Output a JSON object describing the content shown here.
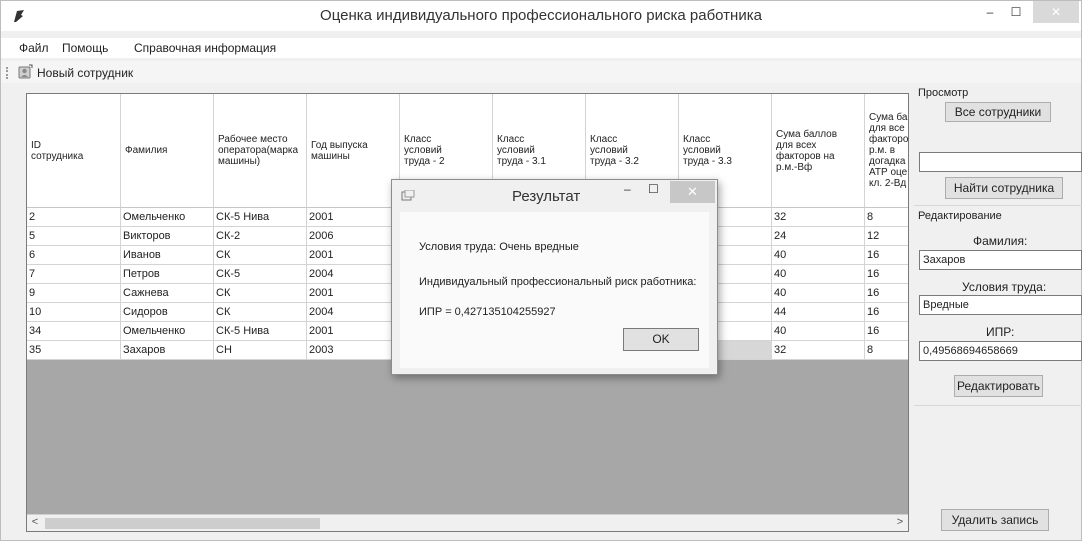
{
  "window": {
    "title": "Оценка индивидуального профессионального риска работника",
    "min_glyph": "–",
    "max_glyph": "☐",
    "close_glyph": "✕"
  },
  "menu": [
    "Файл",
    "Помощь",
    "Справочная информация"
  ],
  "toolbar": {
    "new_employee_label": "Новый сотрудник"
  },
  "grid": {
    "columns": [
      "ID\nсотрудника",
      "Фамилия",
      "Рабочее место\nоператора(марка\nмашины)",
      "Год выпуска\nмашины",
      "Класс\nусловий\nтруда - 2",
      "Класс\nусловий\nтруда - 3.1",
      "Класс\nусловий\nтруда - 3.2",
      "Класс\nусловий\nтруда - 3.3",
      "Сума баллов\nдля всех\nфакторов на\nр.м.-Вф",
      "Сума ба\nдля все\nфакторо\nр.м. в\nдогадка\nАТР оце\nкл. 2-Вд"
    ],
    "rows": [
      [
        "2",
        "Омельченко",
        "СК-5 Нива",
        "2001",
        "",
        "",
        "",
        "",
        "32",
        "8"
      ],
      [
        "5",
        "Викторов",
        "СК-2",
        "2006",
        "",
        "",
        "",
        "",
        "24",
        "12"
      ],
      [
        "6",
        "Иванов",
        "СК",
        "2001",
        "",
        "",
        "",
        "",
        "40",
        "16"
      ],
      [
        "7",
        "Петров",
        "СК-5",
        "2004",
        "",
        "",
        "",
        "",
        "40",
        "16"
      ],
      [
        "9",
        "Сажнева",
        "СК",
        "2001",
        "",
        "",
        "",
        "",
        "40",
        "16"
      ],
      [
        "10",
        "Сидоров",
        "СК",
        "2004",
        "",
        "",
        "",
        "",
        "44",
        "16"
      ],
      [
        "34",
        "Омельченко",
        "СК-5 Нива",
        "2001",
        "",
        "",
        "",
        "",
        "40",
        "16"
      ],
      [
        "35",
        "Захаров",
        "СН",
        "2003",
        "",
        "",
        "",
        "",
        "32",
        "8"
      ]
    ],
    "selected_row": 7,
    "scroll_left": "<",
    "scroll_right": ">"
  },
  "panel": {
    "view_group": "Просмотр",
    "all_employees_button": "Все сотрудники",
    "search_value": "",
    "find_employee_button": "Найти сотрудника",
    "edit_group": "Редактирование",
    "surname_label": "Фамилия:",
    "surname_value": "Захаров",
    "conditions_label": "Условия труда:",
    "conditions_value": "Вредные",
    "ipr_label": "ИПР:",
    "ipr_value": "0,49568694658669",
    "edit_button": "Редактировать",
    "delete_button": "Удалить запись"
  },
  "dialog": {
    "title": "Результат",
    "conditions_line": "Условия труда:   Очень вредные",
    "risk_line": "Индивидуальный профессиональный риск работника:",
    "ipr_line": "ИПР =  0,427135104255927",
    "ok_button": "OK"
  }
}
